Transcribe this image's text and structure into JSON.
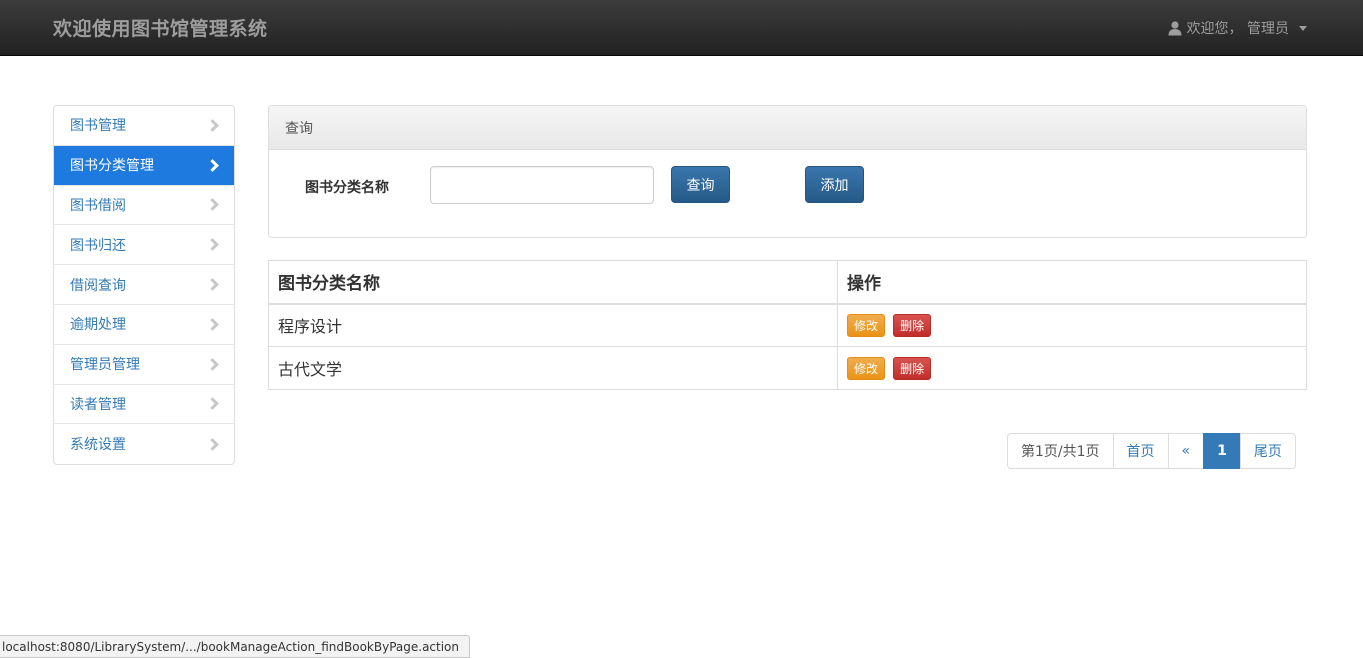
{
  "header": {
    "brand": "欢迎使用图书馆管理系统",
    "user_label": "欢迎您， 管理员"
  },
  "sidebar": {
    "items": [
      {
        "label": "图书管理",
        "active": false
      },
      {
        "label": "图书分类管理",
        "active": true
      },
      {
        "label": "图书借阅",
        "active": false
      },
      {
        "label": "图书归还",
        "active": false
      },
      {
        "label": "借阅查询",
        "active": false
      },
      {
        "label": "逾期处理",
        "active": false
      },
      {
        "label": "管理员管理",
        "active": false
      },
      {
        "label": "读者管理",
        "active": false
      },
      {
        "label": "系统设置",
        "active": false
      }
    ]
  },
  "search": {
    "heading": "查询",
    "field_label": "图书分类名称",
    "value": "",
    "query_button": "查询",
    "add_button": "添加"
  },
  "table": {
    "columns": [
      "图书分类名称",
      "操作"
    ],
    "rows": [
      {
        "name": "程序设计",
        "edit": "修改",
        "delete": "删除"
      },
      {
        "name": "古代文学",
        "edit": "修改",
        "delete": "删除"
      }
    ]
  },
  "pagination": {
    "info": "第1页/共1页",
    "first": "首页",
    "prev": "«",
    "current": "1",
    "last": "尾页"
  },
  "status_bar": {
    "url": "localhost:8080/LibrarySystem/.../bookManageAction_findBookByPage.action"
  },
  "colors": {
    "navbar": "#222222",
    "active_sidebar": "#1f7ae0",
    "primary": "#337ab7",
    "warning": "#f0ad4e",
    "danger": "#d9534f"
  }
}
